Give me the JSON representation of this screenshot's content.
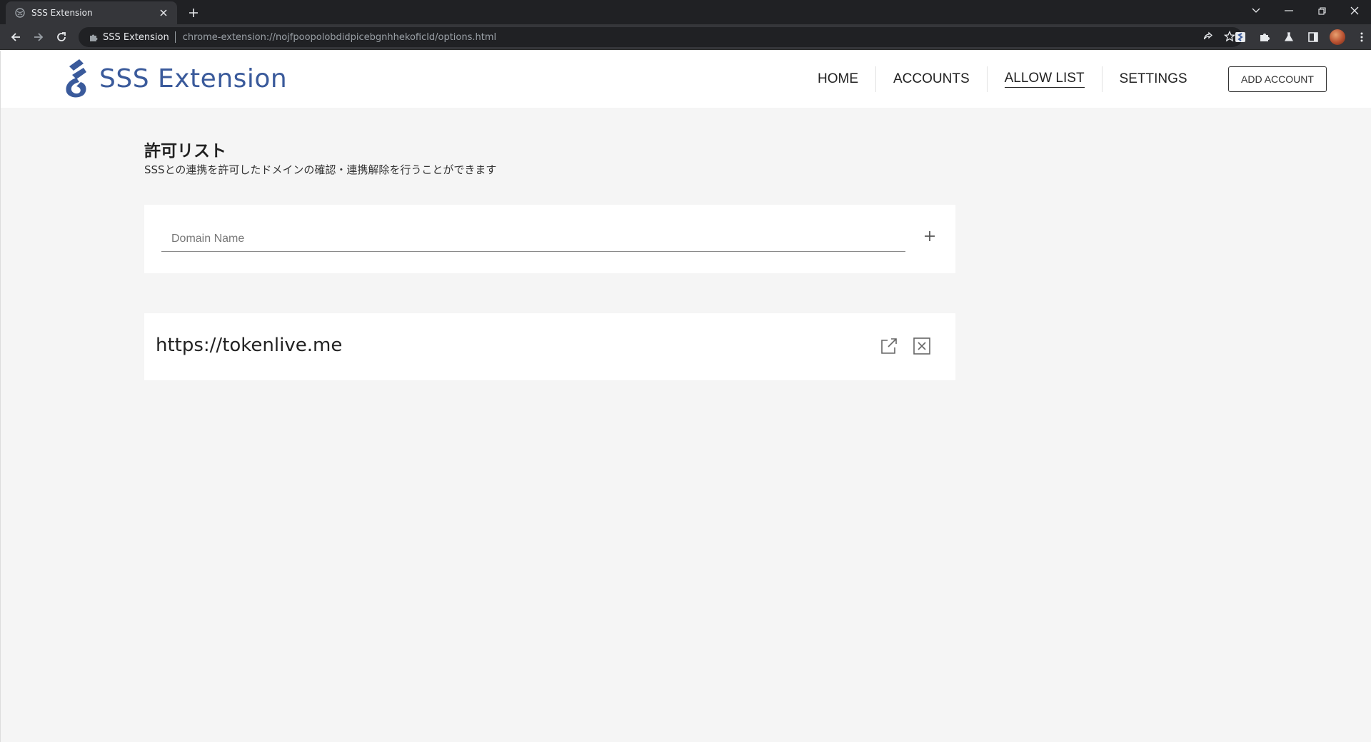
{
  "browser": {
    "tab_title": "SSS Extension",
    "omnibox_site": "SSS Extension",
    "omnibox_url": "chrome-extension://nojfpoopolobdidpicebgnhhekoficld/options.html"
  },
  "header": {
    "logo_text": "SSS Extension",
    "nav": [
      {
        "label": "HOME"
      },
      {
        "label": "ACCOUNTS"
      },
      {
        "label": "ALLOW LIST",
        "active": true
      },
      {
        "label": "SETTINGS"
      }
    ],
    "add_account_label": "ADD ACCOUNT"
  },
  "main": {
    "title": "許可リスト",
    "subtitle": "SSSとの連携を許可したドメインの確認・連携解除を行うことができます",
    "input": {
      "placeholder": "Domain Name",
      "value": ""
    },
    "allow_list": [
      {
        "domain": "https://tokenlive.me"
      }
    ]
  },
  "colors": {
    "brand": "#3a5a9b",
    "background": "#f5f5f5"
  },
  "icons": {
    "tab_favicon": "globe-icon",
    "add": "plus-icon",
    "open": "external-link-icon",
    "remove": "close-box-icon"
  }
}
